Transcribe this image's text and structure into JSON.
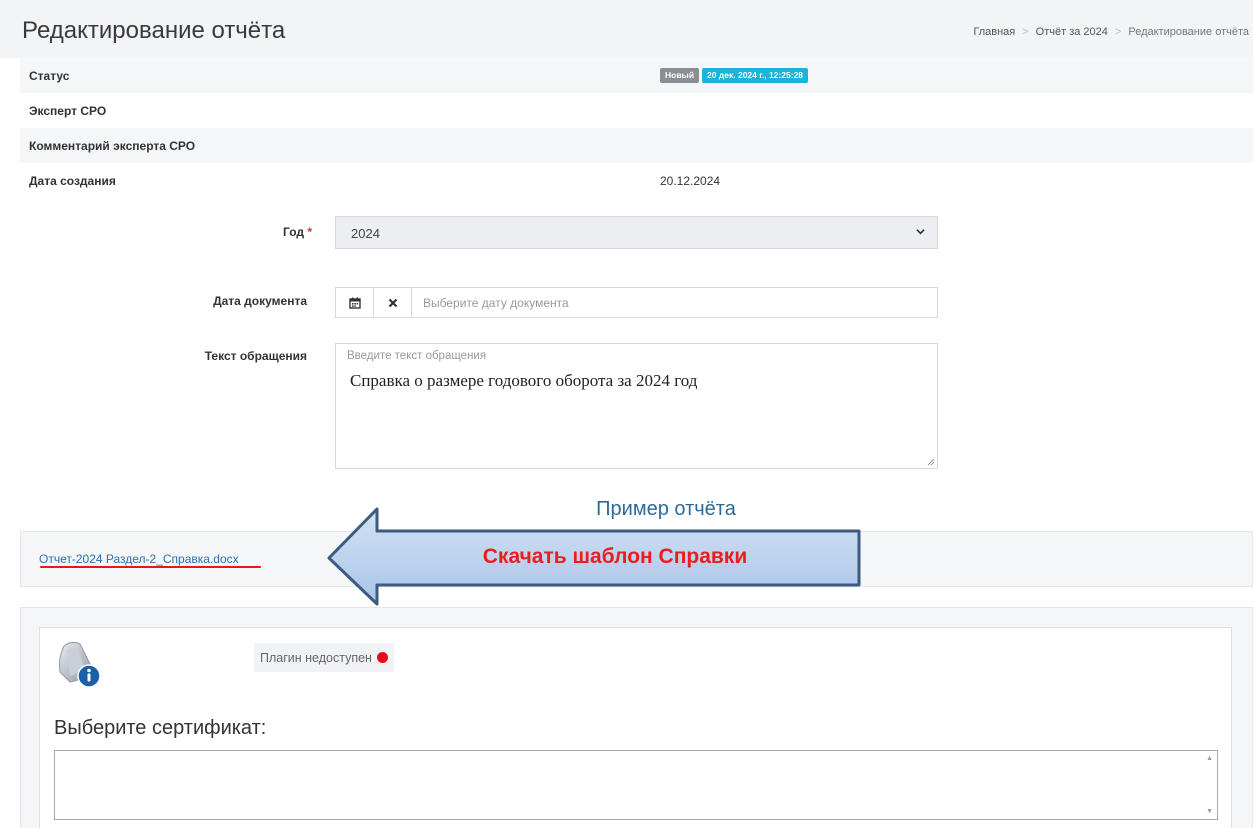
{
  "page": {
    "title": "Редактирование отчёта"
  },
  "breadcrumb": {
    "items": [
      "Главная",
      "Отчёт за 2024",
      "Редактирование отчёта"
    ]
  },
  "info": {
    "rows": [
      {
        "label": "Статус",
        "value": ""
      },
      {
        "label": "Эксперт СРО",
        "value": ""
      },
      {
        "label": "Комментарий эксперта СРО",
        "value": ""
      },
      {
        "label": "Дата создания",
        "value": "20.12.2024"
      }
    ],
    "status_badge": "Новый",
    "status_date_badge": "20 дек. 2024 г., 12:25:28"
  },
  "form": {
    "year": {
      "label": "Год",
      "required_mark": "*",
      "value": "2024"
    },
    "doc_date": {
      "label": "Дата документа",
      "placeholder": "Выберите дату документа",
      "value": ""
    },
    "request_text": {
      "label": "Текст обращения",
      "placeholder": "Введите текст обращения",
      "value": "Справка о размере годового оборота за 2024 год"
    }
  },
  "example": {
    "title": "Пример отчёта",
    "file_name": "Отчет-2024 Раздел-2_Справка.docx"
  },
  "annotation": {
    "arrow_text": "Скачать шаблон Справки"
  },
  "certificate": {
    "plugin_status": "Плагин недоступен",
    "heading": "Выберите сертификат:"
  },
  "colors": {
    "accent_link": "#2b6fb0",
    "badge_new": "#8a8f96",
    "badge_date": "#19b4d9",
    "annotation_red": "#ee1c1c",
    "plugin_dot": "#e5091c"
  },
  "icons": [
    "calendar-icon",
    "clear-icon",
    "chevron-down-icon",
    "info-icon",
    "status-dot-icon"
  ]
}
